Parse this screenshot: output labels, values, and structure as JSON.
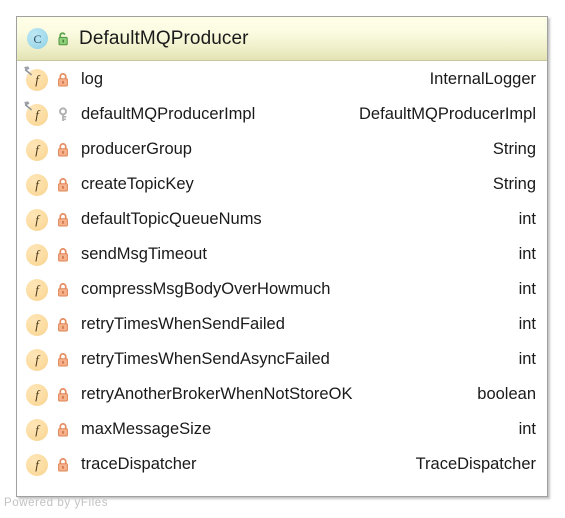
{
  "diagram": {
    "watermark": "Powered by yFiles"
  },
  "node": {
    "header": {
      "class_icon_letter": "C",
      "class_icon_name": "class-icon",
      "visibility_icon": "unlock-green-icon",
      "title": "DefaultMQProducer"
    },
    "members": [
      {
        "kind_letter": "f",
        "kind_icon": "field-icon",
        "static": true,
        "visibility_icon": "lock-orange-icon",
        "name": "log",
        "type": "InternalLogger"
      },
      {
        "kind_letter": "f",
        "kind_icon": "field-icon",
        "static": true,
        "visibility_icon": "key-gray-icon",
        "name": "defaultMQProducerImpl",
        "type": "DefaultMQProducerImpl"
      },
      {
        "kind_letter": "f",
        "kind_icon": "field-icon",
        "static": false,
        "visibility_icon": "lock-orange-icon",
        "name": "producerGroup",
        "type": "String"
      },
      {
        "kind_letter": "f",
        "kind_icon": "field-icon",
        "static": false,
        "visibility_icon": "lock-orange-icon",
        "name": "createTopicKey",
        "type": "String"
      },
      {
        "kind_letter": "f",
        "kind_icon": "field-icon",
        "static": false,
        "visibility_icon": "lock-orange-icon",
        "name": "defaultTopicQueueNums",
        "type": "int"
      },
      {
        "kind_letter": "f",
        "kind_icon": "field-icon",
        "static": false,
        "visibility_icon": "lock-orange-icon",
        "name": "sendMsgTimeout",
        "type": "int"
      },
      {
        "kind_letter": "f",
        "kind_icon": "field-icon",
        "static": false,
        "visibility_icon": "lock-orange-icon",
        "name": "compressMsgBodyOverHowmuch",
        "type": "int"
      },
      {
        "kind_letter": "f",
        "kind_icon": "field-icon",
        "static": false,
        "visibility_icon": "lock-orange-icon",
        "name": "retryTimesWhenSendFailed",
        "type": "int"
      },
      {
        "kind_letter": "f",
        "kind_icon": "field-icon",
        "static": false,
        "visibility_icon": "lock-orange-icon",
        "name": "retryTimesWhenSendAsyncFailed",
        "type": "int"
      },
      {
        "kind_letter": "f",
        "kind_icon": "field-icon",
        "static": false,
        "visibility_icon": "lock-orange-icon",
        "name": "retryAnotherBrokerWhenNotStoreOK",
        "type": "boolean"
      },
      {
        "kind_letter": "f",
        "kind_icon": "field-icon",
        "static": false,
        "visibility_icon": "lock-orange-icon",
        "name": "maxMessageSize",
        "type": "int"
      },
      {
        "kind_letter": "f",
        "kind_icon": "field-icon",
        "static": false,
        "visibility_icon": "lock-orange-icon",
        "name": "traceDispatcher",
        "type": "TraceDispatcher"
      }
    ]
  },
  "colors": {
    "header_gradient_top": "#ffffe8",
    "header_gradient_bottom": "#e3e3b4",
    "node_border": "#a0a0a0",
    "class_icon": "#a5dced",
    "field_icon": "#fcdda2",
    "lock_private": "#f2a07a",
    "key_protected": "#b3b3b3",
    "unlock_public": "#74bf5e",
    "watermark": "#c2c2c2"
  }
}
